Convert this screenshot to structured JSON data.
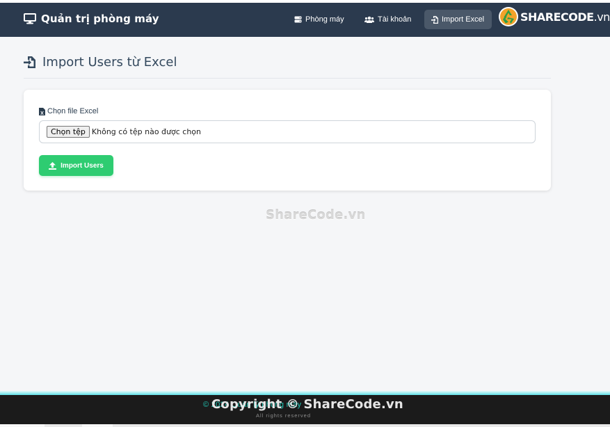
{
  "navbar": {
    "brand": "Quản trị phòng máy",
    "items": [
      {
        "label": "Phòng máy",
        "icon": "server-icon"
      },
      {
        "label": "Tài khoản",
        "icon": "users-icon"
      },
      {
        "label": "Import Excel",
        "icon": "file-import-icon",
        "active": true
      }
    ],
    "logo": {
      "main": "SHARECODE",
      "suffix": ".vn"
    }
  },
  "page": {
    "title": "Import Users từ Excel",
    "field_label": "Chọn file Excel",
    "file_button": "Chọn tệp",
    "file_status": "Không có tệp nào được chọn",
    "submit_label": "Import Users"
  },
  "watermark": "ShareCode.vn",
  "footer": {
    "copyright_line": "© 2024 Quản lý phòng máy",
    "overlay": "Copyright © ShareCode.vn",
    "sub": "All rights reserved"
  },
  "colors": {
    "navbar_bg": "#2b3a4e",
    "active_bg": "#4a5869",
    "accent_green": "#2ecc71",
    "footer_bg": "#1b1b1b"
  }
}
